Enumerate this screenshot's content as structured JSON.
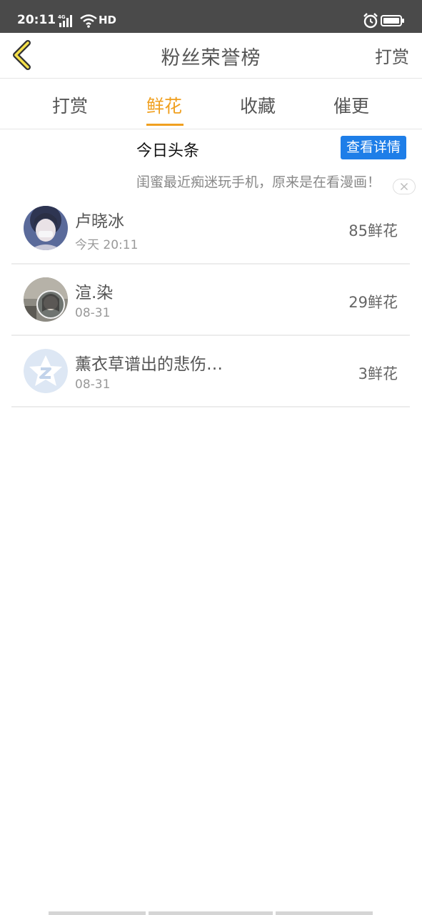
{
  "status_bar": {
    "time": "20:11",
    "network": "4G",
    "hd": "HD"
  },
  "header": {
    "title": "粉丝荣誉榜",
    "action_label": "打赏"
  },
  "tabs": [
    {
      "label": "打赏"
    },
    {
      "label": "鲜花"
    },
    {
      "label": "收藏"
    },
    {
      "label": "催更"
    }
  ],
  "active_tab": "鲜花",
  "headline": {
    "label": "今日头条",
    "button_label": "查看详情",
    "text": "闺蜜最近痴迷玩手机，原来是在看漫画！"
  },
  "fans": [
    {
      "name": "卢晓冰",
      "date": "今天 20:11",
      "amount": "85鲜花"
    },
    {
      "name": "渲.染",
      "date": "08-31",
      "amount": "29鲜花"
    },
    {
      "name": "薰衣草谱出的悲伤…",
      "date": "08-31",
      "amount": "3鲜花"
    }
  ],
  "colors": {
    "accent": "#f0a020",
    "button_blue": "#1e7ee8",
    "status_bar": "#4a4a4a"
  }
}
